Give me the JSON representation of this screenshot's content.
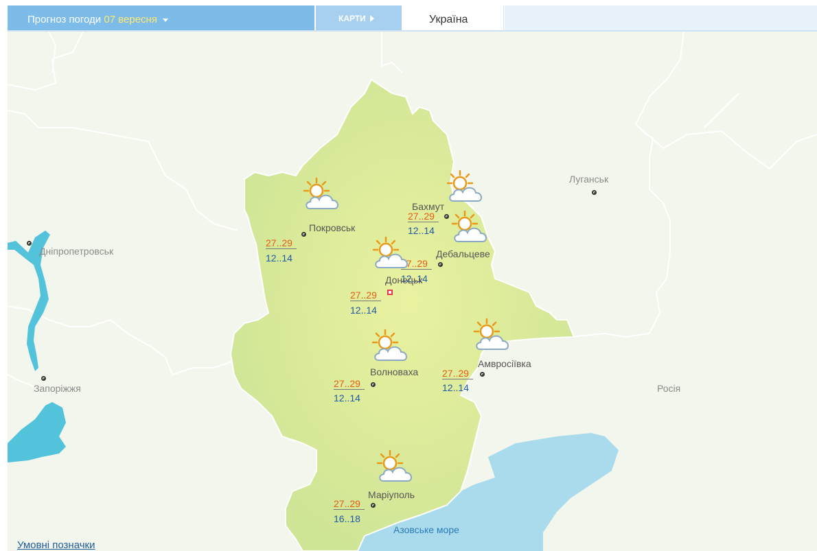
{
  "header": {
    "forecast_label": "Прогноз погоди",
    "forecast_date": "07 вересня",
    "maps_label": "КАРТИ",
    "country_tab": "Україна"
  },
  "colors": {
    "region_fill": "#cfe596",
    "region_center": "#e6f09e",
    "map_bg": "#f3f6ed",
    "water": "#53c3dc",
    "sea": "#a9dbec",
    "border_line": "#ffffff",
    "temp_day": "#e25c16",
    "temp_night": "#1e5aa8",
    "header_bg": "#7dbce8",
    "header_date": "#ffe873"
  },
  "map": {
    "sea_label": "Азовське море",
    "legend_link": "Умовні позначки",
    "region_cities": [
      {
        "name": "Покровськ",
        "day": "27..29",
        "night": "12..14",
        "icon": "partly-cloudy-icon"
      },
      {
        "name": "Бахмут",
        "day": "27..29",
        "night": "12..14",
        "icon": "partly-cloudy-icon"
      },
      {
        "name": "Дебальцеве",
        "day": "27..29",
        "night": "12..14",
        "icon": "partly-cloudy-icon"
      },
      {
        "name": "Донецьк",
        "day": "27..29",
        "night": "12..14",
        "icon": "partly-cloudy-icon"
      },
      {
        "name": "Волноваха",
        "day": "27..29",
        "night": "12..14",
        "icon": "partly-cloudy-icon"
      },
      {
        "name": "Амвросіївка",
        "day": "27..29",
        "night": "12..14",
        "icon": "partly-cloudy-icon"
      },
      {
        "name": "Маріуполь",
        "day": "27..29",
        "night": "16..18",
        "icon": "partly-cloudy-icon"
      }
    ],
    "neighbor_labels": [
      "Дніпропетровськ",
      "Запоріжжя",
      "Луганськ",
      "Росія"
    ]
  }
}
